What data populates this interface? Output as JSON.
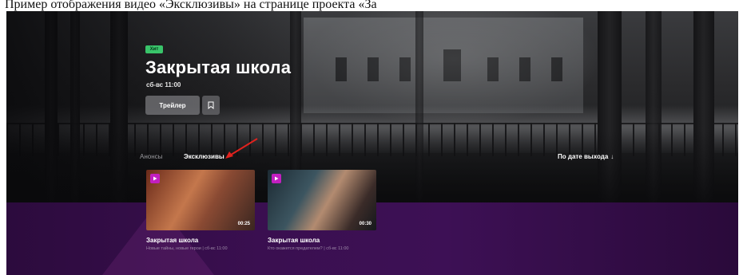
{
  "caption": "Пример отображения видео «Эксклюзивы» на странице проекта «За",
  "hero": {
    "badge": "Хит",
    "title": "Закрытая школа",
    "schedule": "сб-вс 11:00",
    "trailer_label": "Трейлер"
  },
  "tabs": [
    {
      "label": "Анонсы"
    },
    {
      "label": "Эксклюзивы"
    }
  ],
  "sort_label": "По дате выхода",
  "sort_arrow": "↓",
  "cards": [
    {
      "title": "Закрытая школа",
      "subtitle": "Новые тайны, новые герои | сб-вс 11:00",
      "duration": "00:25"
    },
    {
      "title": "Закрытая школа",
      "subtitle": "Кто окажется предателем? | сб-вс 11:00",
      "duration": "00:30"
    }
  ],
  "colors": {
    "badge": "#39c46a",
    "play_badge": "#c21fc0",
    "purple": "#3a0f50",
    "annotation_arrow": "#e0221e"
  }
}
